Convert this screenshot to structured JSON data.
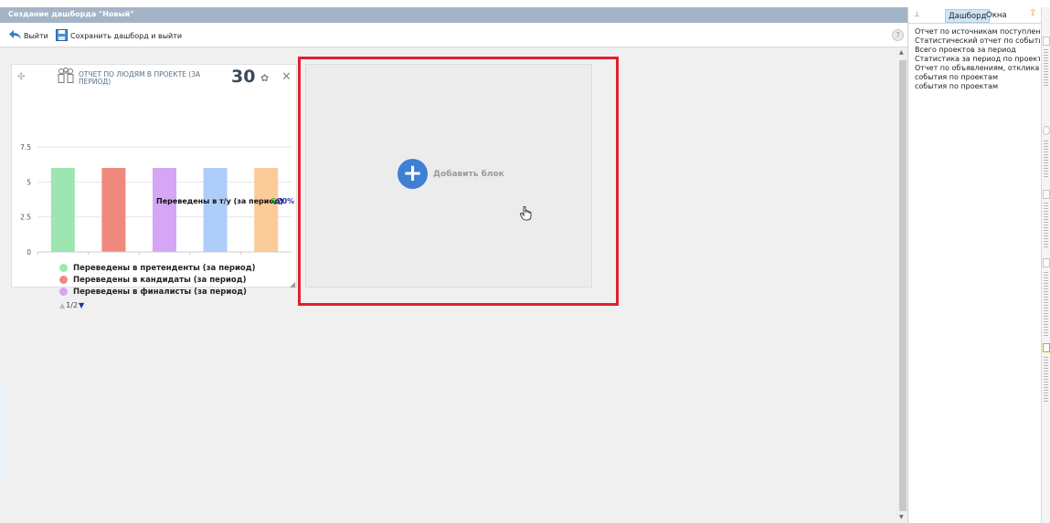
{
  "window": {
    "title": "Создание дашборда \"Новый\""
  },
  "toolbar": {
    "exit_label": "Выйти",
    "save_label": "Сохранить дашборд и выйти",
    "help_icon": "question-icon"
  },
  "widget": {
    "title": "ОТЧЕТ ПО ЛЮДЯМ В ПРОЕКТЕ (ЗА ПЕРИОД)",
    "count": "30",
    "tooltip": {
      "label": "Переведены в т/у (за период)",
      "value": "6",
      "percent": "20%"
    },
    "pager": {
      "current": "1/2"
    },
    "legend": [
      {
        "label": "Переведены в претенденты (за период)",
        "color": "#9ee6b1"
      },
      {
        "label": "Переведены в кандидаты (за период)",
        "color": "#ee8a7d"
      },
      {
        "label": "Переведены в финалисты (за период)",
        "color": "#d4a6f3"
      }
    ]
  },
  "chart_data": {
    "type": "bar",
    "categories": [
      "Переведены в претенденты (за период)",
      "Переведены в кандидаты (за период)",
      "Переведены в финалисты (за период)",
      "",
      "Переведены в т/у (за период)"
    ],
    "values": [
      6,
      6,
      6,
      6,
      6
    ],
    "colors": [
      "#9ee6b1",
      "#ee8a7d",
      "#d4a6f3",
      "#aecdf9",
      "#fccb9a"
    ],
    "yticks": [
      "0",
      "2.5",
      "5",
      "7.5"
    ],
    "ylim": [
      0,
      7.5
    ],
    "grid": true
  },
  "addblock": {
    "label": "Добавить блок"
  },
  "sidepanel": {
    "tabs": [
      {
        "label": "Дашборд",
        "active": true
      },
      {
        "label": "Окна",
        "active": false
      }
    ],
    "items": [
      "Отчет по источникам поступления",
      "Статистический отчет по событиям",
      "Всего проектов за период",
      "Статистика за период по проектам",
      "Отчет по объявлениям, откликам",
      "события по проектам",
      "события по проектам"
    ]
  },
  "colors": {
    "accent": "#3f7fd4",
    "highlight": "#e0202e",
    "titlebar": "#a3b4c6"
  }
}
